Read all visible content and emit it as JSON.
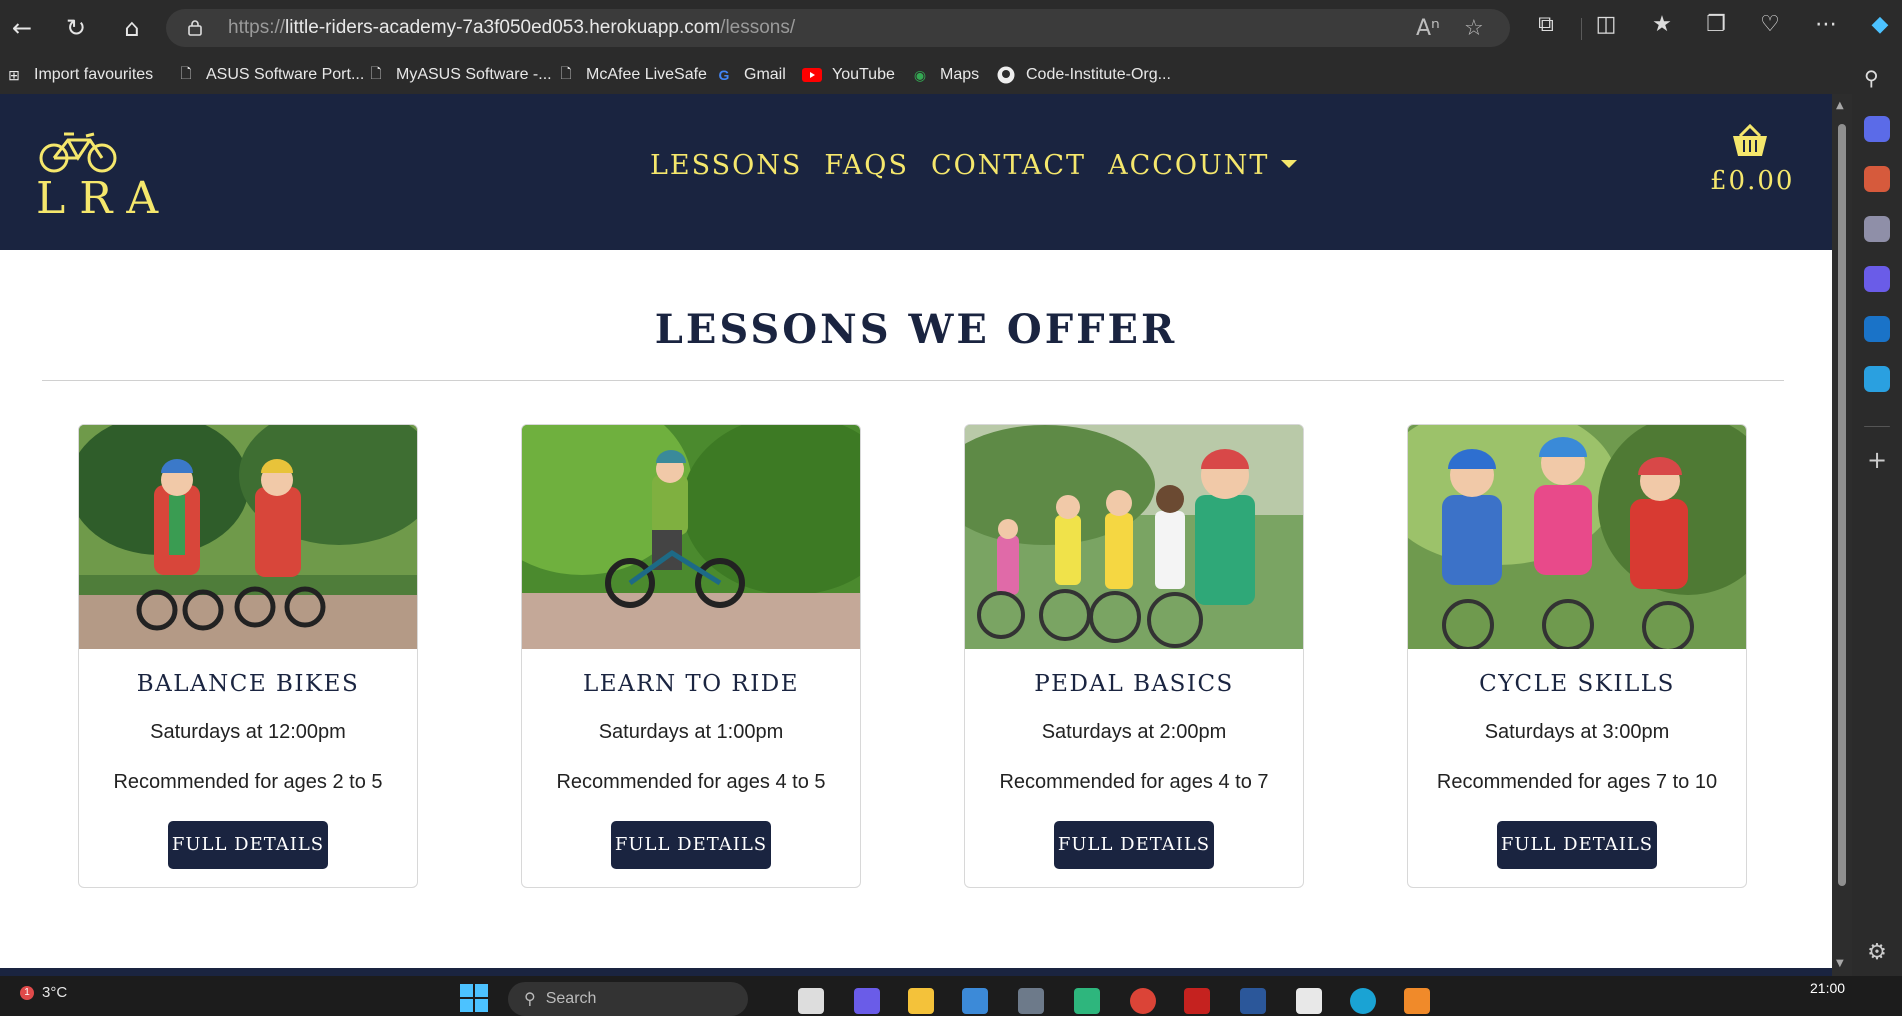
{
  "browser": {
    "url_prefix": "https://",
    "url_host": "little-riders-academy-7a3f050ed053.herokuapp.com",
    "url_path": "/lessons/",
    "bookmarks": [
      {
        "label": "Import favourites",
        "icon": "import-icon"
      },
      {
        "label": "ASUS Software Port...",
        "icon": "page-icon"
      },
      {
        "label": "MyASUS Software -...",
        "icon": "page-icon"
      },
      {
        "label": "McAfee LiveSafe",
        "icon": "page-icon"
      },
      {
        "label": "Gmail",
        "icon": "google-icon"
      },
      {
        "label": "YouTube",
        "icon": "youtube-icon"
      },
      {
        "label": "Maps",
        "icon": "maps-icon"
      },
      {
        "label": "Code-Institute-Org...",
        "icon": "github-icon"
      }
    ]
  },
  "site": {
    "logo_text": "LRA",
    "nav": [
      {
        "label": "LESSONS"
      },
      {
        "label": "FAQS"
      },
      {
        "label": "CONTACT"
      },
      {
        "label": "ACCOUNT"
      }
    ],
    "basket_total": "£0.00",
    "colors": {
      "navy": "#1a2440",
      "yellow": "#f5e76c"
    }
  },
  "page": {
    "heading": "LESSONS WE OFFER",
    "lessons": [
      {
        "title": "BALANCE BIKES",
        "time": "Saturdays at 12:00pm",
        "age": "Recommended for ages 2 to 5",
        "button": "FULL DETAILS"
      },
      {
        "title": "LEARN TO RIDE",
        "time": "Saturdays at 1:00pm",
        "age": "Recommended for ages 4 to 5",
        "button": "FULL DETAILS"
      },
      {
        "title": "PEDAL BASICS",
        "time": "Saturdays at 2:00pm",
        "age": "Recommended for ages 4 to 7",
        "button": "FULL DETAILS"
      },
      {
        "title": "CYCLE SKILLS",
        "time": "Saturdays at 3:00pm",
        "age": "Recommended for ages 7 to 10",
        "button": "FULL DETAILS"
      }
    ]
  },
  "taskbar": {
    "weather": "3°C",
    "weather_badge": "1",
    "search_placeholder": "Search",
    "clock": "21:00"
  }
}
